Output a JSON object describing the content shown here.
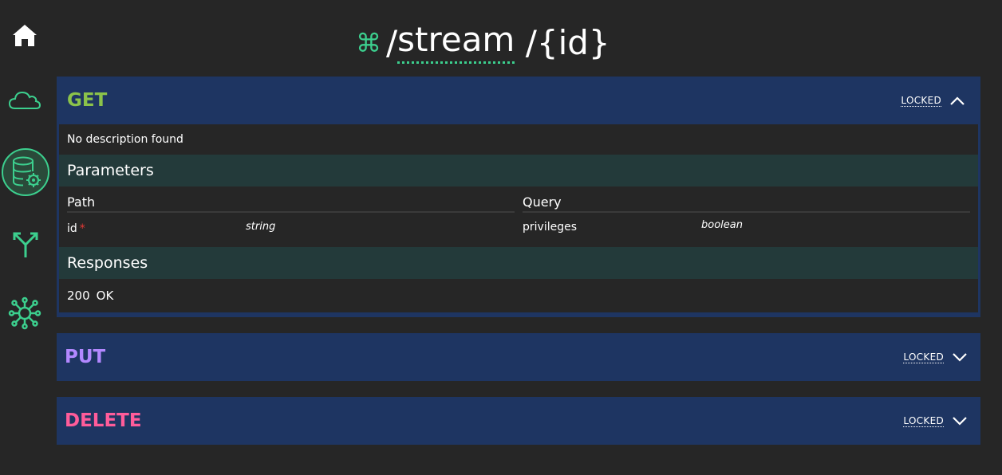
{
  "sidebar": {
    "items": [
      {
        "icon": "home-icon"
      },
      {
        "icon": "cloud-icon"
      },
      {
        "icon": "database-settings-icon",
        "active": true
      },
      {
        "icon": "merge-icon"
      },
      {
        "icon": "hub-icon"
      }
    ]
  },
  "header": {
    "icon": "command-icon",
    "path_prefix": "/",
    "path_resource": "stream",
    "path_param": " /{id}"
  },
  "endpoints": {
    "get": {
      "method": "GET",
      "color": "#8bc34a",
      "locked_label": "LOCKED",
      "expanded": true,
      "description": "No description found",
      "parameters_title": "Parameters",
      "path_title": "Path",
      "path_params": [
        {
          "name": "id",
          "required_mark": "*",
          "type": "string"
        }
      ],
      "query_title": "Query",
      "query_params": [
        {
          "name": "privileges",
          "type": "boolean"
        }
      ],
      "responses_title": "Responses",
      "responses": [
        {
          "code": "200",
          "text": "OK"
        }
      ]
    },
    "put": {
      "method": "PUT",
      "color": "#b388ff",
      "locked_label": "LOCKED",
      "expanded": false
    },
    "delete": {
      "method": "DELETE",
      "color": "#ff5c9a",
      "locked_label": "LOCKED",
      "expanded": false
    }
  },
  "colors": {
    "accent": "#3ccf8e",
    "panel": "#1e3562",
    "section": "#233a3a",
    "background": "#262626"
  }
}
